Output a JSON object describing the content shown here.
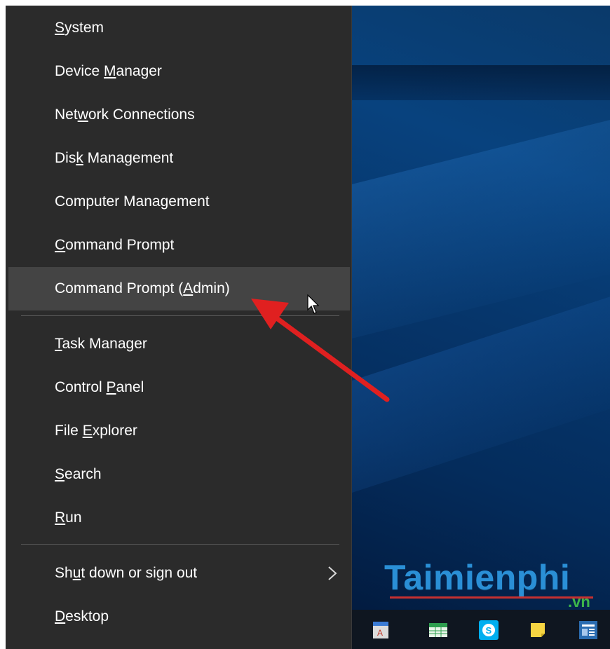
{
  "menu": {
    "items": [
      {
        "before": "",
        "key": "S",
        "after": "ystem"
      },
      {
        "before": "Device ",
        "key": "M",
        "after": "anager"
      },
      {
        "before": "Net",
        "key": "w",
        "after": "ork Connections"
      },
      {
        "before": "Dis",
        "key": "k",
        "after": " Management"
      },
      {
        "before": "Computer Mana",
        "key": "g",
        "after": "ement"
      },
      {
        "before": "",
        "key": "C",
        "after": "ommand Prompt"
      },
      {
        "before": "Command Prompt (",
        "key": "A",
        "after": "dmin)"
      },
      {
        "before": "",
        "key": "T",
        "after": "ask Manager"
      },
      {
        "before": "Control ",
        "key": "P",
        "after": "anel"
      },
      {
        "before": "File ",
        "key": "E",
        "after": "xplorer"
      },
      {
        "before": "",
        "key": "S",
        "after": "earch"
      },
      {
        "before": "",
        "key": "R",
        "after": "un"
      },
      {
        "before": "Sh",
        "key": "u",
        "after": "t down or sign out"
      },
      {
        "before": "",
        "key": "D",
        "after": "esktop"
      }
    ],
    "highlighted_item": "Command Prompt (Admin)",
    "highlight_color": "#444444",
    "background_color": "#2b2b2b"
  },
  "annotation": {
    "arrow_color": "#e02020"
  },
  "watermark": {
    "main": "Taimienphi",
    "sub": ".vn"
  },
  "taskbar": {
    "icons": [
      "document-app-icon",
      "spreadsheet-app-icon",
      "skype-icon",
      "sticky-notes-icon",
      "news-app-icon"
    ]
  }
}
